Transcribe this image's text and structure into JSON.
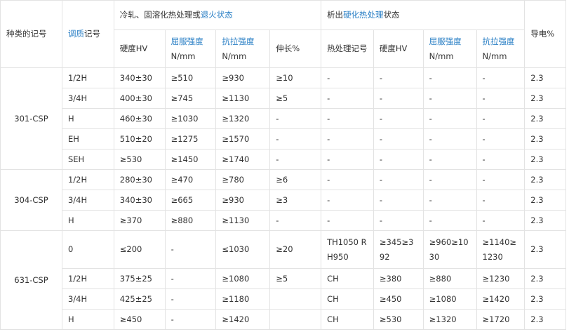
{
  "header": {
    "kind_code": "种类的记号",
    "temper": {
      "link": "调质",
      "rest": "记号"
    },
    "group1": {
      "pre": "冷轧、固溶化热处理或",
      "link": "退火状态"
    },
    "group2": {
      "pre": "析出",
      "link": "硬化热处理",
      "post": "状态"
    },
    "hardness": "硬度HV",
    "yield": "屈服强度",
    "tensile": "抗拉强度",
    "unit": "N/mm",
    "elong": "伸长%",
    "heat_code": "热处理记号",
    "cond": "导电%"
  },
  "groups": [
    {
      "kind": "301-CSP",
      "rows": [
        {
          "temper": "1/2H",
          "hv": "340±30",
          "ys": "≥510",
          "ts": "≥930",
          "el": "≥10",
          "ht": "-",
          "hv2": "-",
          "ys2": "-",
          "ts2": "-",
          "cond": "2.3"
        },
        {
          "temper": "3/4H",
          "hv": "400±30",
          "ys": "≥745",
          "ts": "≥1130",
          "el": "≥5",
          "ht": "-",
          "hv2": "-",
          "ys2": "-",
          "ts2": "-",
          "cond": "2.3"
        },
        {
          "temper": "H",
          "hv": "460±30",
          "ys": "≥1030",
          "ts": "≥1320",
          "el": "-",
          "ht": "-",
          "hv2": "-",
          "ys2": "-",
          "ts2": "-",
          "cond": "2.3"
        },
        {
          "temper": "EH",
          "hv": "510±20",
          "ys": "≥1275",
          "ts": "≥1570",
          "el": "-",
          "ht": "-",
          "hv2": "-",
          "ys2": "-",
          "ts2": "-",
          "cond": "2.3"
        },
        {
          "temper": "SEH",
          "hv": "≥530",
          "ys": "≥1450",
          "ts": "≥1740",
          "el": "-",
          "ht": "-",
          "hv2": "-",
          "ys2": "-",
          "ts2": "-",
          "cond": "2.3"
        }
      ]
    },
    {
      "kind": "304-CSP",
      "rows": [
        {
          "temper": "1/2H",
          "hv": "280±30",
          "ys": "≥470",
          "ts": "≥780",
          "el": "≥6",
          "ht": "-",
          "hv2": "-",
          "ys2": "-",
          "ts2": "-",
          "cond": "2.3"
        },
        {
          "temper": "3/4H",
          "hv": "340±30",
          "ys": "≥665",
          "ts": "≥930",
          "el": "≥3",
          "ht": "-",
          "hv2": "-",
          "ys2": "-",
          "ts2": "-",
          "cond": "2.3"
        },
        {
          "temper": "H",
          "hv": "≥370",
          "ys": "≥880",
          "ts": "≥1130",
          "el": "-",
          "ht": "-",
          "hv2": "-",
          "ys2": "-",
          "ts2": "-",
          "cond": "2.3"
        }
      ]
    },
    {
      "kind": "631-CSP",
      "rows": [
        {
          "temper": "0",
          "hv": "≤200",
          "ys": "-",
          "ts": "≤1030",
          "el": "≥20",
          "ht": "TH1050 RH950",
          "hv2": "≥345≥392",
          "ys2": "≥960≥1030",
          "ts2": "≥1140≥1230",
          "cond": "2.3"
        },
        {
          "temper": "1/2H",
          "hv": "375±25",
          "ys": "-",
          "ts": "≥1080",
          "el": "≥5",
          "ht": "CH",
          "hv2": "≥380",
          "ys2": "≥880",
          "ts2": "≥1230",
          "cond": "2.3"
        },
        {
          "temper": "3/4H",
          "hv": "425±25",
          "ys": "-",
          "ts": "≥1180",
          "el": "",
          "ht": "CH",
          "hv2": "≥450",
          "ys2": "≥1080",
          "ts2": "≥1420",
          "cond": "2.3"
        },
        {
          "temper": "H",
          "hv": "≥450",
          "ys": "-",
          "ts": "≥1420",
          "el": "",
          "ht": "CH",
          "hv2": "≥530",
          "ys2": "≥1320",
          "ts2": "≥1720",
          "cond": "2.3"
        }
      ]
    }
  ]
}
